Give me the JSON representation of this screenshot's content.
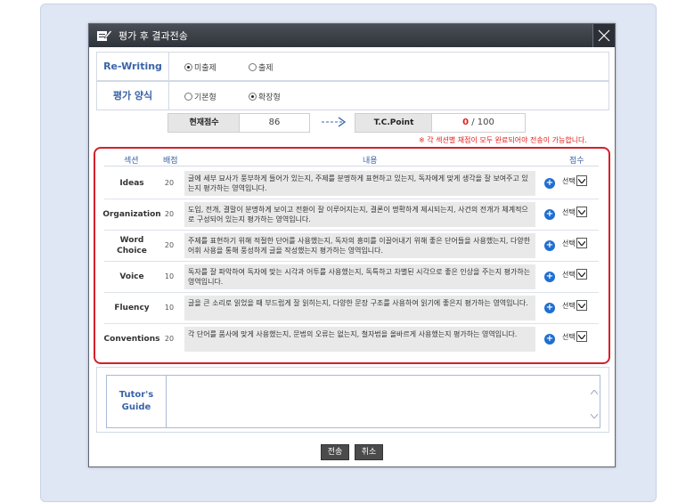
{
  "dialog": {
    "title": "평가 후 결과전송"
  },
  "rewriting": {
    "label": "Re-Writing",
    "options": [
      "미출제",
      "출제"
    ],
    "selected": "미출제"
  },
  "eval_type": {
    "label": "평가 양식",
    "options": [
      "기본형",
      "확장형"
    ],
    "selected": "확장형"
  },
  "scores": {
    "current_label": "현재점수",
    "current_value": "86",
    "tc_label": "T.C.Point",
    "tc_value": "0",
    "tc_max": "/ 100"
  },
  "notice": "※ 각 섹션별 채점이 모두 완료되어야 전송이 가능합니다.",
  "table": {
    "headers": {
      "section": "섹션",
      "points": "배점",
      "content": "내용",
      "score": "점수"
    },
    "rows": [
      {
        "section": "Ideas",
        "points": "20",
        "desc": "글에 세부 묘사가 풍부하게 들어가 있는지, 주제를 분명하게 표현하고 있는지, 독자에게 맞게 생각을 잘 보여주고 있는지 평가하는 영역입니다.",
        "select": "선택"
      },
      {
        "section": "Organization",
        "points": "20",
        "desc": "도입, 전개, 결말이 분명하게 보이고 전환이 잘 이루어지는지, 결론이 명확하게 제시되는지, 사건의 전개가 체계적으로 구성되어 있는지 평가하는 영역입니다.",
        "select": "선택"
      },
      {
        "section": "Word Choice",
        "points": "20",
        "desc": "주제를 표현하기 위해 적절한 단어를 사용했는지, 독자의 흥미를 이끌어내기 위해 좋은 단어들을 사용했는지, 다양한 어휘 사용을 통해 풍성하게 글을 작성했는지 평가하는 영역입니다.",
        "select": "선택"
      },
      {
        "section": "Voice",
        "points": "10",
        "desc": "독자를 잘 파악하여 독자에 맞는 시각과 어투를 사용했는지, 독특하고 차별된 시각으로 좋은 인상을 주는지 평가하는 영역입니다.",
        "select": "선택"
      },
      {
        "section": "Fluency",
        "points": "10",
        "desc": "글을 큰 소리로 읽었을 때 부드럽게 잘 읽히는지, 다양한 문장 구조를 사용하여 읽기에 좋은지 평가하는 영역입니다.",
        "select": "선택"
      },
      {
        "section": "Conventions",
        "points": "20",
        "desc": "각 단어를 품사에 맞게 사용했는지, 문법의 오류는 없는지, 철자법을 올바르게 사용했는지 평가하는 영역입니다.",
        "select": "선택"
      }
    ]
  },
  "guide": {
    "label": "Tutor's Guide",
    "value": ""
  },
  "buttons": {
    "send": "전송",
    "cancel": "취소"
  },
  "colors": {
    "accent_blue": "#3a64a8",
    "highlight_red": "#d4202a",
    "titlebar": "#3a3e45"
  }
}
